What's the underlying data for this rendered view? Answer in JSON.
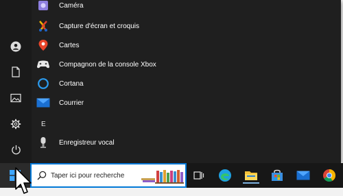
{
  "start_menu": {
    "apps": [
      {
        "label": "Caméra",
        "icon": "camera-icon"
      },
      {
        "label": "Capture d'écran et croquis",
        "icon": "snip-sketch-icon"
      },
      {
        "label": "Cartes",
        "icon": "maps-pin-icon"
      },
      {
        "label": "Compagnon de la console Xbox",
        "icon": "xbox-controller-icon"
      },
      {
        "label": "Cortana",
        "icon": "cortana-ring-icon"
      },
      {
        "label": "Courrier",
        "icon": "mail-envelope-icon"
      }
    ],
    "section_letter": "E",
    "apps_e": [
      {
        "label": "Enregistreur vocal",
        "icon": "microphone-icon"
      }
    ],
    "rail": [
      "user-icon",
      "document-icon",
      "pictures-icon",
      "settings-gear-icon",
      "power-icon"
    ]
  },
  "taskbar": {
    "search_placeholder": "Taper ici pour recherche",
    "pinned": [
      "task-view-icon",
      "edge-icon",
      "file-explorer-icon",
      "store-icon",
      "mail-icon",
      "chrome-icon"
    ]
  },
  "colors": {
    "accent": "#0078d7",
    "menu_bg": "#1e1e1e",
    "taskbar_bg": "#171717"
  }
}
